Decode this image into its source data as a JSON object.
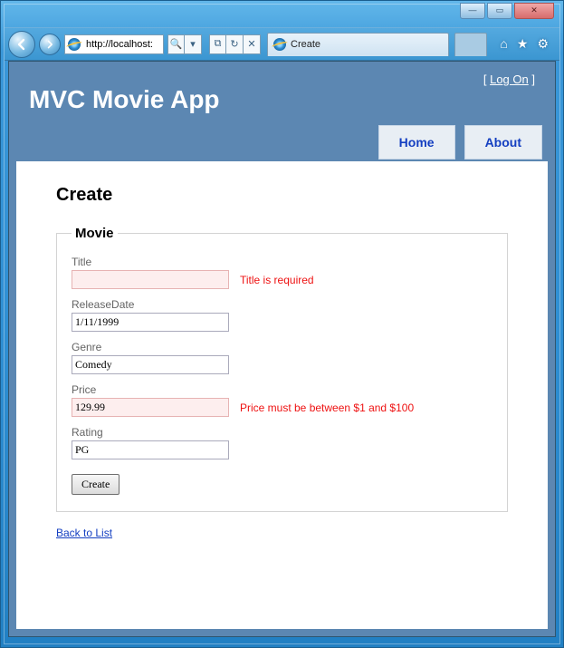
{
  "window": {
    "minimize_glyph": "—",
    "maximize_glyph": "▭",
    "close_glyph": "✕"
  },
  "browser": {
    "url": "http://localhost:",
    "tab_title": "Create",
    "dropdown_glyph": "▾",
    "search_glyph": "🔍",
    "compat_glyph": "⧉",
    "refresh_glyph": "↻",
    "stop_glyph": "✕",
    "home_glyph": "⌂",
    "fav_glyph": "★",
    "tools_glyph": "⚙"
  },
  "site": {
    "title": "MVC Movie App",
    "login_prefix": "[",
    "login_link": "Log On",
    "login_suffix": "]",
    "nav": {
      "home": "Home",
      "about": "About"
    }
  },
  "page": {
    "heading": "Create",
    "legend": "Movie",
    "fields": {
      "title": {
        "label": "Title",
        "value": "",
        "error": "Title is required"
      },
      "releaseDate": {
        "label": "ReleaseDate",
        "value": "1/11/1999",
        "error": ""
      },
      "genre": {
        "label": "Genre",
        "value": "Comedy",
        "error": ""
      },
      "price": {
        "label": "Price",
        "value": "129.99",
        "error": "Price must be between $1 and $100"
      },
      "rating": {
        "label": "Rating",
        "value": "PG",
        "error": ""
      }
    },
    "submit_label": "Create",
    "back_link": "Back to List"
  }
}
